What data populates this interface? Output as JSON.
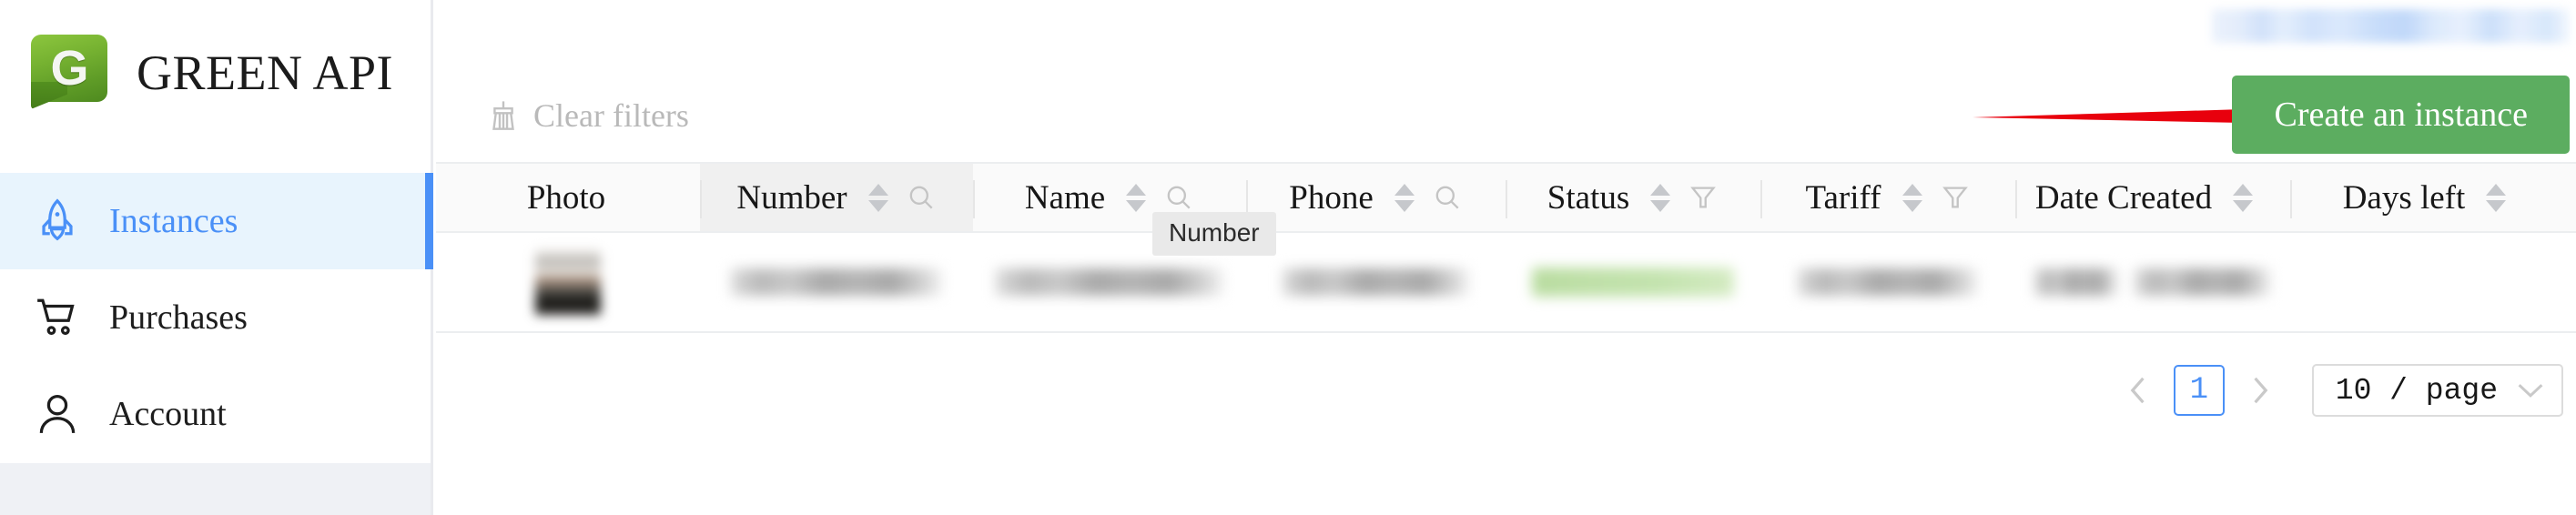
{
  "brand": {
    "logo_letter": "G",
    "name": "GREEN API",
    "logo_color": "#5f9c27"
  },
  "sidebar": {
    "items": [
      {
        "label": "Instances",
        "icon": "rocket-icon",
        "active": true
      },
      {
        "label": "Purchases",
        "icon": "cart-icon",
        "active": false
      },
      {
        "label": "Account",
        "icon": "user-icon",
        "active": false
      }
    ]
  },
  "toolbar": {
    "clear_filters_label": "Clear filters",
    "clear_filters_icon": "broom-icon",
    "create_instance_label": "Create an instance",
    "create_instance_color": "#5cad60",
    "annotation_arrow_color": "#e8000d"
  },
  "table": {
    "columns": [
      {
        "label": "Photo",
        "sortable": false,
        "tool": "none"
      },
      {
        "label": "Number",
        "sortable": true,
        "tool": "search-icon",
        "hovered": true,
        "tooltip": "Number"
      },
      {
        "label": "Name",
        "sortable": true,
        "tool": "search-icon"
      },
      {
        "label": "Phone",
        "sortable": true,
        "tool": "search-icon"
      },
      {
        "label": "Status",
        "sortable": true,
        "tool": "filter-icon"
      },
      {
        "label": "Tariff",
        "sortable": true,
        "tool": "filter-icon"
      },
      {
        "label": "Date Created",
        "sortable": true,
        "tool": "none"
      },
      {
        "label": "Days left",
        "sortable": true,
        "tool": "none"
      }
    ],
    "rows": [
      {
        "photo": "",
        "number": "",
        "name": "",
        "phone": "",
        "status": "",
        "tariff": "",
        "date_created": "",
        "days_left": "",
        "redacted": true
      }
    ]
  },
  "pagination": {
    "prev_icon": "chevron-left-icon",
    "next_icon": "chevron-right-icon",
    "current_page": "1",
    "page_size": "10 / page",
    "page_size_chevron": "chevron-down-icon"
  }
}
